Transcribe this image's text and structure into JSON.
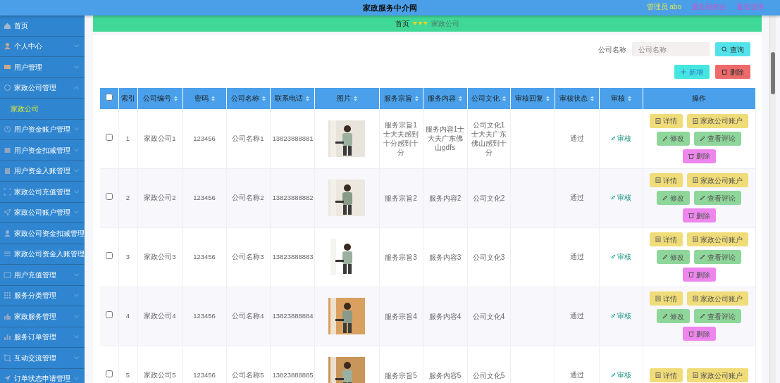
{
  "header": {
    "title": "家政服务中介网",
    "user": "管理员 abo",
    "links": [
      "退出到前台",
      "退出登录"
    ]
  },
  "sidebar": {
    "items": [
      {
        "label": "首页",
        "kind": "link"
      },
      {
        "label": "个人中心",
        "kind": "menu",
        "expanded": false
      },
      {
        "label": "用户管理",
        "kind": "menu",
        "expanded": false
      },
      {
        "label": "家政公司管理",
        "kind": "menu",
        "expanded": true,
        "children": [
          {
            "label": "家政公司",
            "selected": true
          }
        ]
      },
      {
        "label": "用户资金账户管理",
        "kind": "menu",
        "expanded": false
      },
      {
        "label": "用户资金扣减管理",
        "kind": "menu",
        "expanded": false
      },
      {
        "label": "用户资金入账管理",
        "kind": "menu",
        "expanded": false
      },
      {
        "label": "家政公司充值管理",
        "kind": "menu",
        "expanded": false
      },
      {
        "label": "家政公司账户管理",
        "kind": "menu",
        "expanded": false
      },
      {
        "label": "家政公司资金扣减管理",
        "kind": "link"
      },
      {
        "label": "家政公司资金入账管理",
        "kind": "link"
      },
      {
        "label": "用户充值管理",
        "kind": "menu",
        "expanded": false
      },
      {
        "label": "服务分类管理",
        "kind": "menu",
        "expanded": false
      },
      {
        "label": "家政服务管理",
        "kind": "menu",
        "expanded": false
      },
      {
        "label": "服务订单管理",
        "kind": "menu",
        "expanded": false
      },
      {
        "label": "互动交流管理",
        "kind": "menu",
        "expanded": false
      },
      {
        "label": "订单状态申请管理",
        "kind": "menu",
        "expanded": false
      }
    ]
  },
  "breadcrumb": [
    "首页",
    "家政公司"
  ],
  "search": {
    "label": "公司名称",
    "placeholder": "公司名称",
    "button": "查询"
  },
  "actions": [
    {
      "label": "新增",
      "kind": "add"
    },
    {
      "label": "删除",
      "kind": "delete"
    }
  ],
  "table": {
    "select_all": {
      "checked": false
    },
    "columns": [
      {
        "label": "索引",
        "sortable": false
      },
      {
        "label": "公司编号",
        "sortable": true
      },
      {
        "label": "密码",
        "sortable": true
      },
      {
        "label": "公司名称",
        "sortable": true
      },
      {
        "label": "联系电话",
        "sortable": true
      },
      {
        "label": "图片",
        "sortable": true
      },
      {
        "label": "服务宗旨",
        "sortable": true
      },
      {
        "label": "服务内容",
        "sortable": true
      },
      {
        "label": "公司文化",
        "sortable": true
      },
      {
        "label": "审核回复",
        "sortable": true
      },
      {
        "label": "审核状态",
        "sortable": true
      },
      {
        "label": "审核",
        "sortable": true
      },
      {
        "label": "操作",
        "sortable": false
      }
    ],
    "rows": [
      {
        "selected": false,
        "index": "1",
        "company_no": "家政公司1",
        "password": "123456",
        "company_name": "公司名称1",
        "phone": "13823888881",
        "purpose": "服务宗旨1士大夫感到十分感到十分",
        "content": "服务内容1士大夫广东佛山gdfs",
        "culture": "公司文化1 士大夫广东佛山感到十分",
        "status": "通过",
        "review": "审核",
        "buttons": [
          {
            "label": "详情",
            "kind": "detail"
          },
          {
            "label": "家政公司账户",
            "kind": "account"
          },
          {
            "label": "修改",
            "kind": "edit"
          },
          {
            "label": "查看评论",
            "kind": "comments"
          },
          {
            "label": "删除",
            "kind": "delete"
          }
        ]
      },
      {
        "selected": false,
        "index": "2",
        "company_no": "家政公司2",
        "password": "123456",
        "company_name": "公司名称2",
        "phone": "13823888882",
        "purpose": "服务宗旨2",
        "content": "服务内容2",
        "culture": "公司文化2",
        "status": "通过",
        "review": "审核",
        "buttons": [
          {
            "label": "详情",
            "kind": "detail"
          },
          {
            "label": "家政公司账户",
            "kind": "account"
          },
          {
            "label": "修改",
            "kind": "edit"
          },
          {
            "label": "查看评论",
            "kind": "comments"
          },
          {
            "label": "删除",
            "kind": "delete"
          }
        ]
      },
      {
        "selected": false,
        "index": "3",
        "company_no": "家政公司3",
        "password": "123456",
        "company_name": "公司名称3",
        "phone": "13823888883",
        "purpose": "服务宗旨3",
        "content": "服务内容3",
        "culture": "公司文化3",
        "status": "通过",
        "review": "审核",
        "buttons": [
          {
            "label": "详情",
            "kind": "detail"
          },
          {
            "label": "家政公司账户",
            "kind": "account"
          },
          {
            "label": "修改",
            "kind": "edit"
          },
          {
            "label": "查看评论",
            "kind": "comments"
          },
          {
            "label": "删除",
            "kind": "delete"
          }
        ]
      },
      {
        "selected": false,
        "index": "4",
        "company_no": "家政公司4",
        "password": "123456",
        "company_name": "公司名称4",
        "phone": "13823888884",
        "purpose": "服务宗旨4",
        "content": "服务内容4",
        "culture": "公司文化4",
        "status": "通过",
        "review": "审核",
        "buttons": [
          {
            "label": "详情",
            "kind": "detail"
          },
          {
            "label": "家政公司账户",
            "kind": "account"
          },
          {
            "label": "修改",
            "kind": "edit"
          },
          {
            "label": "查看评论",
            "kind": "comments"
          },
          {
            "label": "删除",
            "kind": "delete"
          }
        ]
      },
      {
        "selected": false,
        "index": "5",
        "company_no": "家政公司5",
        "password": "123456",
        "company_name": "公司名称5",
        "phone": "13823888885",
        "purpose": "服务宗旨5",
        "content": "服务内容5",
        "culture": "公司文化5",
        "status": "通过",
        "review": "审核",
        "buttons": [
          {
            "label": "详情",
            "kind": "detail"
          },
          {
            "label": "家政公司账户",
            "kind": "account"
          }
        ]
      }
    ]
  }
}
